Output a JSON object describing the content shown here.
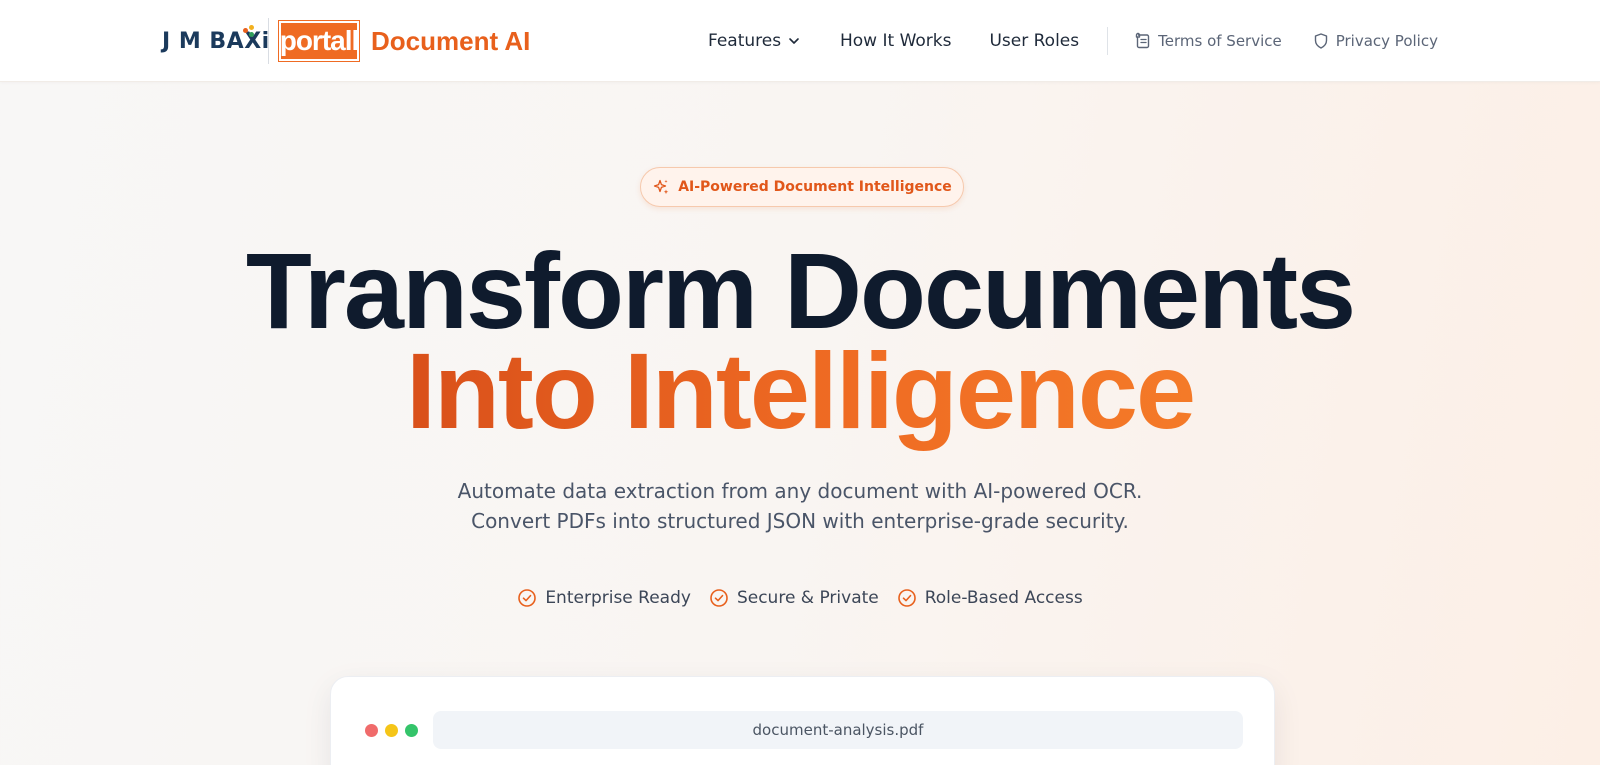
{
  "header": {
    "brand": {
      "company": "J M BAXi",
      "company_dot_colors": [
        "#e8601c",
        "#f2b01e",
        "#2e9e5b"
      ],
      "partner": "portall",
      "product": "Document AI"
    },
    "nav": {
      "features_label": "Features",
      "how_it_works_label": "How It Works",
      "user_roles_label": "User Roles",
      "terms_label": "Terms of Service",
      "privacy_label": "Privacy Policy"
    }
  },
  "hero": {
    "badge": "AI-Powered Document Intelligence",
    "headline_line1": "Transform Documents",
    "headline_line2": "Into Intelligence",
    "subtitle_line1": "Automate data extraction from any document with AI-powered OCR.",
    "subtitle_line2": "Convert PDFs into structured JSON with enterprise-grade security.",
    "features": [
      {
        "label": "Enterprise Ready",
        "icon": "check-circle-icon"
      },
      {
        "label": "Secure & Private",
        "icon": "check-circle-icon"
      },
      {
        "label": "Role-Based Access",
        "icon": "check-circle-icon"
      }
    ]
  },
  "preview": {
    "filename": "document-analysis.pdf",
    "window_dot_colors": [
      "#f06b6b",
      "#f5c518",
      "#34c46a"
    ]
  },
  "colors": {
    "accent": "#e8601c",
    "heading": "#0f1b2d",
    "text_muted": "#4a5568"
  }
}
